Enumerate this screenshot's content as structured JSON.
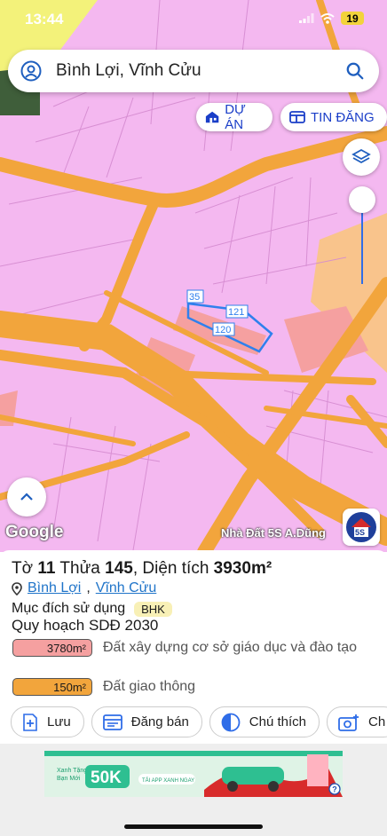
{
  "status": {
    "time": "13:44",
    "battery": "19"
  },
  "search": {
    "query": "Bình Lợi, Vĩnh Cửu"
  },
  "chips": {
    "du_an": "DỰ ÁN",
    "tin_dang": "TIN ĐĂNG"
  },
  "map": {
    "parcel_labels": [
      "35",
      "121",
      "120"
    ],
    "google_label": "Google",
    "watermark": "Nhà Đất 5S A.Dũng",
    "logo_text": "5S",
    "colors": {
      "residential": "#f4b8f0",
      "road": "#f2a53c",
      "education": "#f5a0a0",
      "other": "#f9c48c",
      "agri": "#f3f27a"
    }
  },
  "details": {
    "to_label": "Tờ",
    "to_value": "11",
    "thua_label": "Thửa",
    "thua_value": "145",
    "area_label": "Diện tích",
    "area_value": "3930m²",
    "ward": "Bình Lợi",
    "district": "Vĩnh Cửu",
    "purpose_label": "Mục đích sử dụng",
    "purpose_code": "BHK",
    "plan_title": "Quy hoạch SDĐ 2030",
    "legend": [
      {
        "area": "3780m²",
        "desc": "Đất xây dựng cơ sở giáo dục và đào tạo",
        "color": "#f5a0a0"
      },
      {
        "area": "150m²",
        "desc": "Đất giao thông",
        "color": "#f2a53c"
      }
    ]
  },
  "actions": [
    "Lưu",
    "Đăng bán",
    "Chú thích",
    "Ch"
  ],
  "ad": {
    "line1": "Xanh Tặng",
    "line2": "Bạn Mới",
    "amount": "50K",
    "cta": "TẢI APP XANH NGAY"
  }
}
